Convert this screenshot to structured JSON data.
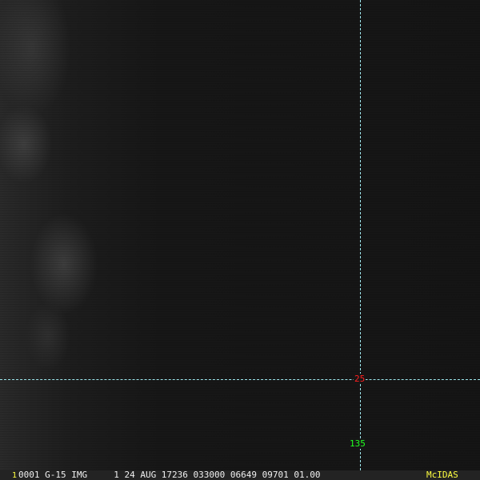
{
  "overlay": {
    "latitude_label": "25",
    "longitude_label": "135",
    "grid_color": "#9ee8ee",
    "lat_color": "#ff2020",
    "lon_color": "#20ff20"
  },
  "status_bar": {
    "frame_number": "1",
    "info": "0001 G-15 IMG     1 24 AUG 17236 033000 06649 09701 01.00",
    "brand": "McIDAS"
  }
}
